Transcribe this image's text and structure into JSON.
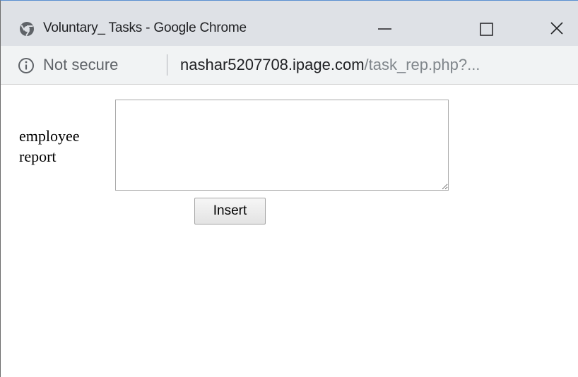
{
  "window": {
    "title": "Voluntary_ Tasks - Google Chrome",
    "app_icon": "chrome-icon",
    "controls": {
      "minimize_icon": "minimize-icon",
      "maximize_icon": "maximize-icon",
      "close_icon": "close-icon"
    }
  },
  "addressbar": {
    "security_icon": "info-icon",
    "security_text": "Not secure",
    "url_host": "nashar5207708.ipage.com",
    "url_path": "/task_rep.php?..."
  },
  "form": {
    "label": "employee report",
    "report_value": "",
    "submit_label": "Insert"
  }
}
